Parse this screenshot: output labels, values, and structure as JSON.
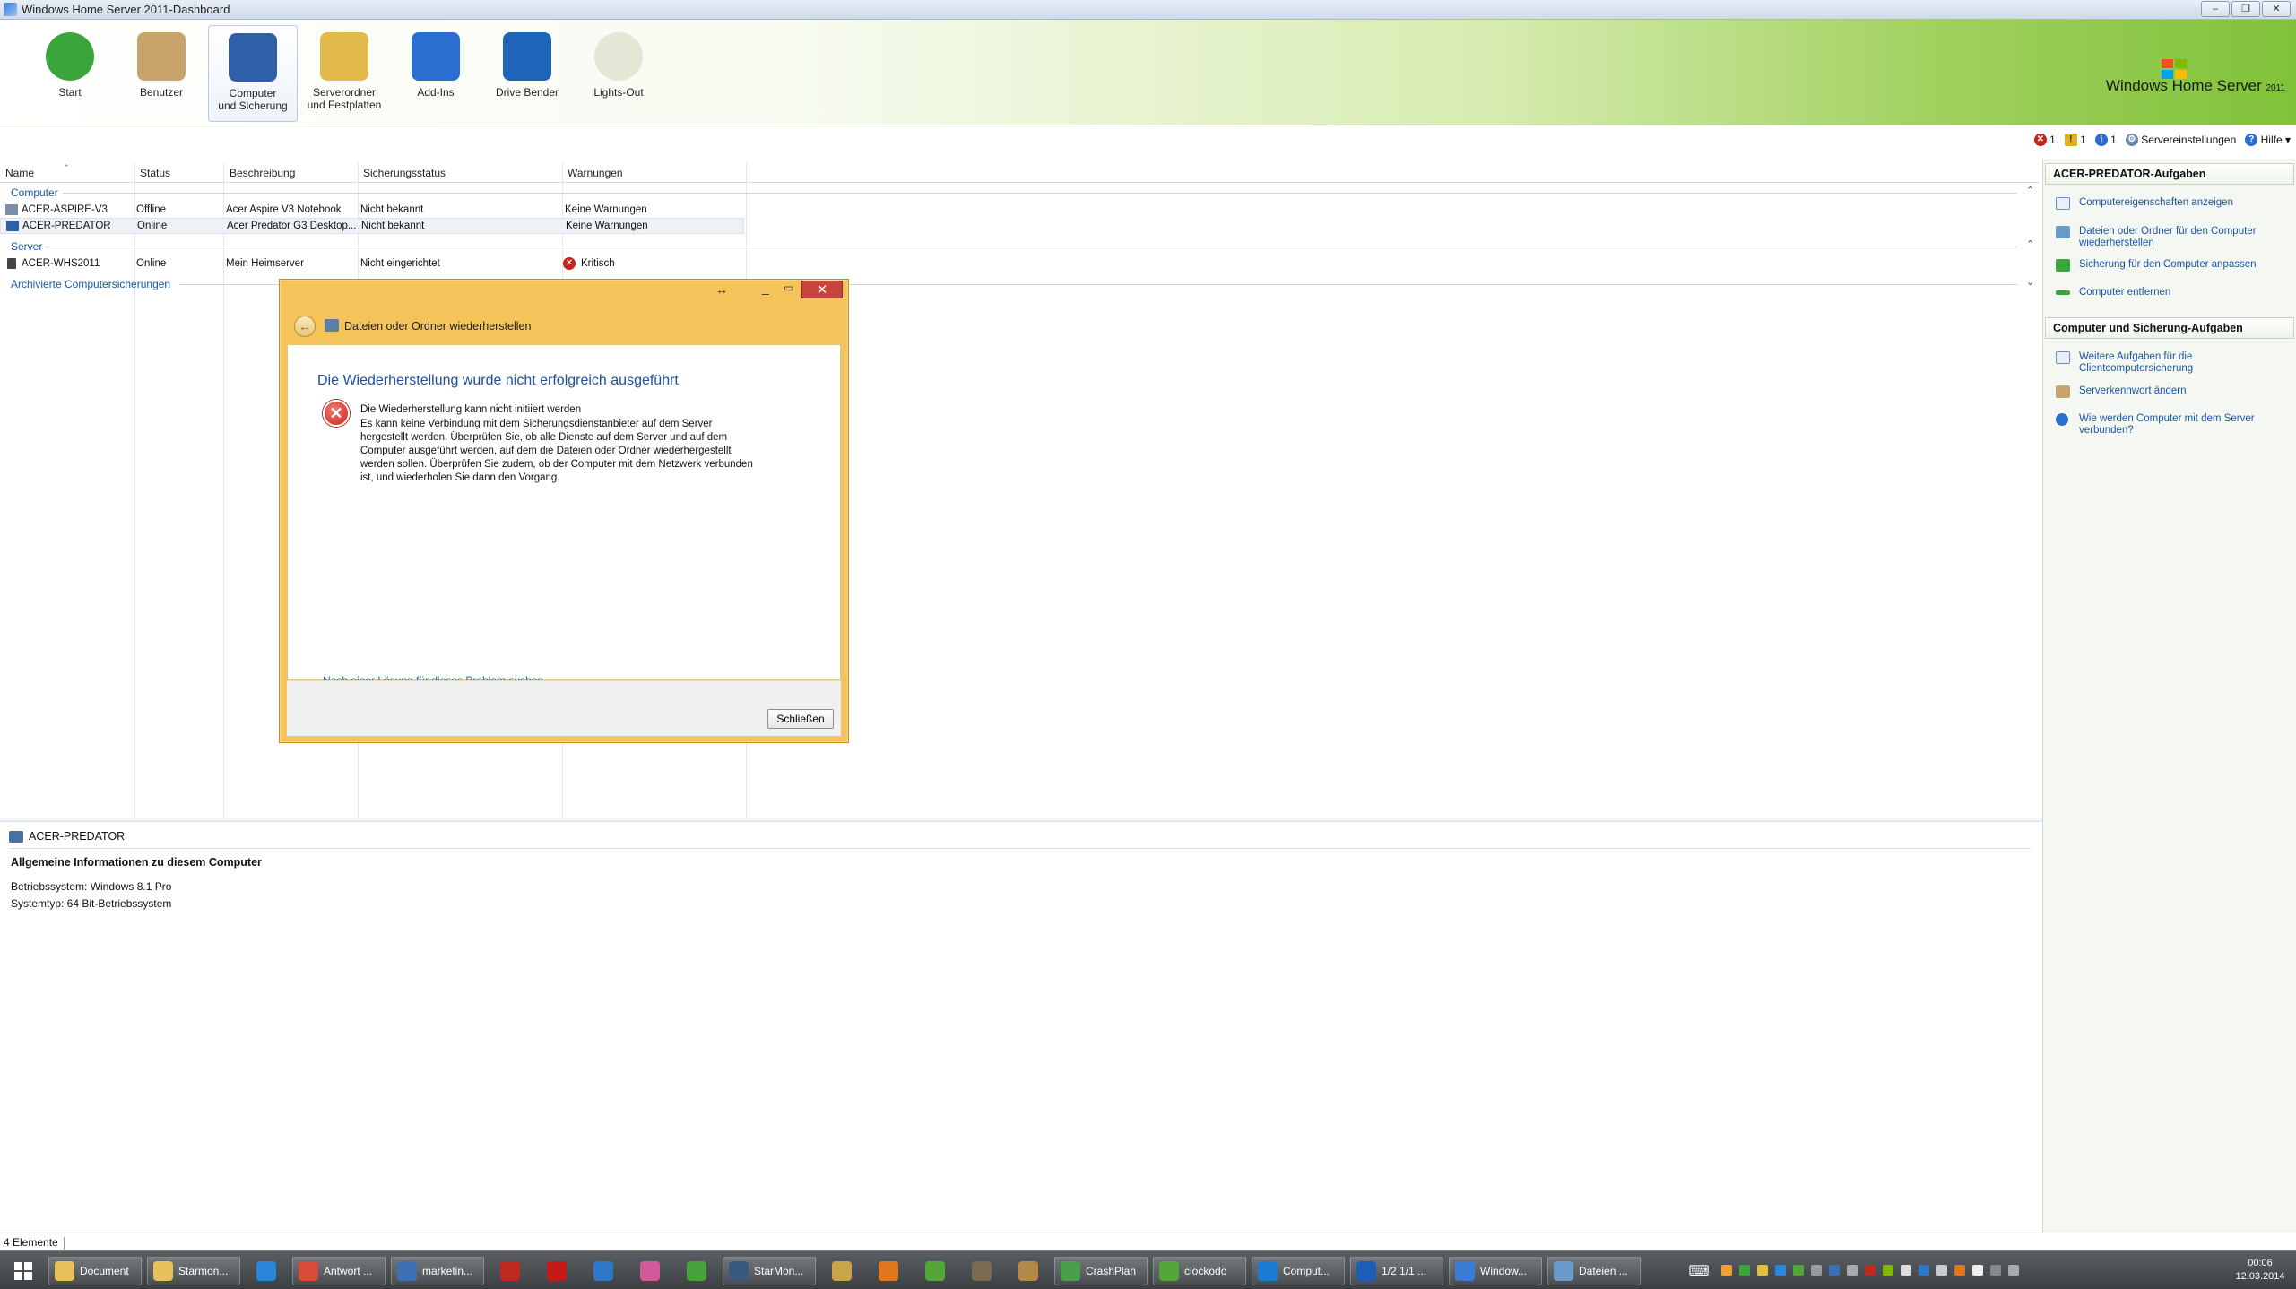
{
  "window": {
    "title": "Windows Home Server 2011-Dashboard",
    "minimize": "–",
    "maximize": "❐",
    "close": "✕"
  },
  "ribbon": {
    "items": [
      {
        "label": "Start",
        "icon": "home-icon",
        "color": "#3aa53a"
      },
      {
        "label": "Benutzer",
        "icon": "users-icon",
        "color": "#c9a46a"
      },
      {
        "label": "Computer\nund Sicherung",
        "icon": "computer-icon",
        "color": "#2f5fa8"
      },
      {
        "label": "Serverordner\nund Festplatten",
        "icon": "folder-icon",
        "color": "#e3b94b"
      },
      {
        "label": "Add-Ins",
        "icon": "addins-icon",
        "color": "#2a6fd0"
      },
      {
        "label": "Drive Bender",
        "icon": "drive-bender-icon",
        "color": "#1e64b8"
      },
      {
        "label": "Lights-Out",
        "icon": "bulb-icon",
        "color": "#e6e6d6"
      }
    ],
    "brand": "Windows Home Server",
    "brand_year": "2011"
  },
  "status": {
    "errors": "1",
    "warnings": "1",
    "infos": "1",
    "settings": "Servereinstellungen",
    "help": "Hilfe"
  },
  "list": {
    "columns": [
      "Name",
      "Status",
      "Beschreibung",
      "Sicherungsstatus",
      "Warnungen"
    ],
    "groups": {
      "computer": "Computer",
      "server": "Server",
      "archived": "Archivierte Computersicherungen"
    },
    "computers": [
      {
        "name": "ACER-ASPIRE-V3",
        "status": "Offline",
        "description": "Acer Aspire V3 Notebook",
        "backup": "Nicht bekannt",
        "warnings": "Keine Warnungen"
      },
      {
        "name": "ACER-PREDATOR",
        "status": "Online",
        "description": "Acer Predator G3 Desktop...",
        "backup": "Nicht bekannt",
        "warnings": "Keine Warnungen"
      }
    ],
    "servers": [
      {
        "name": "ACER-WHS2011",
        "status": "Online",
        "description": "Mein Heimserver",
        "backup": "Nicht eingerichtet",
        "warnings": "Kritisch"
      }
    ]
  },
  "details": {
    "title": "ACER-PREDATOR",
    "section": "Allgemeine Informationen zu diesem Computer",
    "os": "Betriebssystem: Windows 8.1 Pro",
    "type": "Systemtyp: 64 Bit-Betriebssystem"
  },
  "statusbar": {
    "count": "4 Elemente"
  },
  "tasks": {
    "header1": "ACER-PREDATOR-Aufgaben",
    "items1": [
      "Computereigenschaften anzeigen",
      "Dateien oder Ordner für den Computer wiederherstellen",
      "Sicherung für den Computer anpassen",
      "Computer entfernen"
    ],
    "header2": "Computer und Sicherung-Aufgaben",
    "items2": [
      "Weitere Aufgaben für die Clientcomputersicherung",
      "Serverkennwort ändern",
      "Wie werden Computer mit dem Server verbunden?"
    ]
  },
  "dialog": {
    "title": "Dateien oder Ordner wiederherstellen",
    "heading": "Die Wiederherstellung wurde nicht erfolgreich ausgeführt",
    "error_title": "Die Wiederherstellung kann nicht initiiert werden",
    "error_body": "Es kann keine Verbindung mit dem Sicherungsdienstanbieter auf dem Server hergestellt werden. Überprüfen Sie, ob alle Dienste auf dem Server und auf dem Computer ausgeführt werden, auf dem die Dateien oder Ordner wiederhergestellt werden sollen. Überprüfen Sie zudem, ob der Computer mit dem Netzwerk verbunden ist, und wiederholen Sie dann den Vorgang.",
    "link": "Nach einer Lösung für dieses Problem suchen...",
    "close_button": "Schließen"
  },
  "taskbar": {
    "items": [
      {
        "label": "Document",
        "icon": "folder-icon",
        "color": "#e9c15a"
      },
      {
        "label": "Starmon...",
        "icon": "folder-icon",
        "color": "#e9c15a"
      },
      {
        "label": "",
        "icon": "ie-icon",
        "color": "#2a86d8"
      },
      {
        "label": "Antwort ...",
        "icon": "chrome-icon",
        "color": "#d94a3b"
      },
      {
        "label": "marketin...",
        "icon": "thunderbird-icon",
        "color": "#3d6fb5"
      },
      {
        "label": "",
        "icon": "power-icon",
        "color": "#c0291f"
      },
      {
        "label": "",
        "icon": "filezilla-icon",
        "color": "#c41a1a"
      },
      {
        "label": "",
        "icon": "media-icon",
        "color": "#2f78c7"
      },
      {
        "label": "",
        "icon": "paint-icon",
        "color": "#d05a9a"
      },
      {
        "label": "",
        "icon": "evernote-icon",
        "color": "#48a33c"
      },
      {
        "label": "StarMon...",
        "icon": "starmoney-icon",
        "color": "#39597e"
      },
      {
        "label": "",
        "icon": "wizard-icon",
        "color": "#c8a44a"
      },
      {
        "label": "",
        "icon": "firefox-icon",
        "color": "#e0761e"
      },
      {
        "label": "",
        "icon": "clockodo-icon",
        "color": "#55a638"
      },
      {
        "label": "",
        "icon": "gimp-icon",
        "color": "#7a6a52"
      },
      {
        "label": "",
        "icon": "picture-icon",
        "color": "#b58a48"
      },
      {
        "label": "CrashPlan",
        "icon": "crashplan-icon",
        "color": "#4aa04a"
      },
      {
        "label": "clockodo",
        "icon": "clockodo-icon",
        "color": "#55a638"
      },
      {
        "label": "Comput...",
        "icon": "teamviewer-icon",
        "color": "#1a7ad4"
      },
      {
        "label": "1/2  1/1 ...",
        "icon": "word-icon",
        "color": "#1d5fb8"
      },
      {
        "label": "Window...",
        "icon": "whs-icon",
        "color": "#3a7bd5"
      },
      {
        "label": "Dateien ...",
        "icon": "restore-icon",
        "color": "#6a9ac8"
      }
    ],
    "time": "00:06",
    "date": "12.03.2014"
  }
}
